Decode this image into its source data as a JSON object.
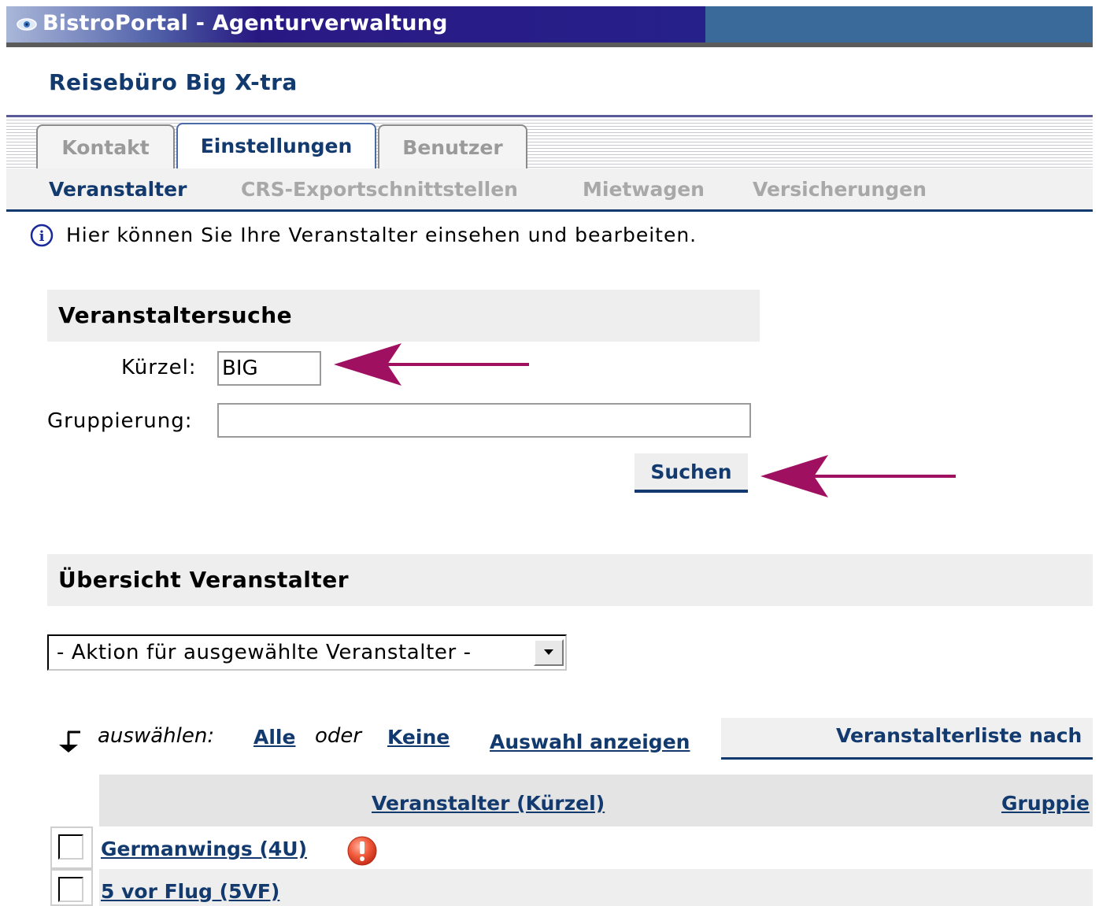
{
  "window": {
    "title": "BistroPortal - Agenturverwaltung",
    "icon": "eye-icon"
  },
  "agency": {
    "name": "Reisebüro Big X-tra"
  },
  "tabs": [
    {
      "label": "Kontakt",
      "active": false
    },
    {
      "label": "Einstellungen",
      "active": true
    },
    {
      "label": "Benutzer",
      "active": false
    }
  ],
  "subnav": [
    {
      "label": "Veranstalter",
      "active": true
    },
    {
      "label": "CRS-Exportschnittstellen",
      "active": false
    },
    {
      "label": "Mietwagen",
      "active": false
    },
    {
      "label": "Versicherungen",
      "active": false
    }
  ],
  "info": {
    "icon": "info-icon",
    "text": "Hier können Sie Ihre Veranstalter einsehen und bearbeiten."
  },
  "search": {
    "title": "Veranstaltersuche",
    "kuerzel_label": "Kürzel:",
    "kuerzel_value": "BIG",
    "gruppierung_label": "Gruppierung:",
    "gruppierung_value": "",
    "button_label": "Suchen"
  },
  "overview": {
    "title": "Übersicht Veranstalter",
    "action_select": "- Aktion für ausgewählte Veranstalter -",
    "select_prefix": "auswählen:",
    "select_all": "Alle",
    "select_or": "oder",
    "select_none": "Keine",
    "show_selection": "Auswahl anzeigen",
    "sort_label": "Veranstalterliste nach"
  },
  "table": {
    "columns": [
      "Veranstalter (Kürzel)",
      "Gruppie"
    ],
    "rows": [
      {
        "name": "Germanwings (4U)",
        "warning": true
      },
      {
        "name": "5 vor Flug (5VF)",
        "warning": false
      }
    ]
  },
  "colors": {
    "accent": "#123a6e",
    "annotation_arrow": "#a01060",
    "titlebar": "#1c0e6e"
  }
}
